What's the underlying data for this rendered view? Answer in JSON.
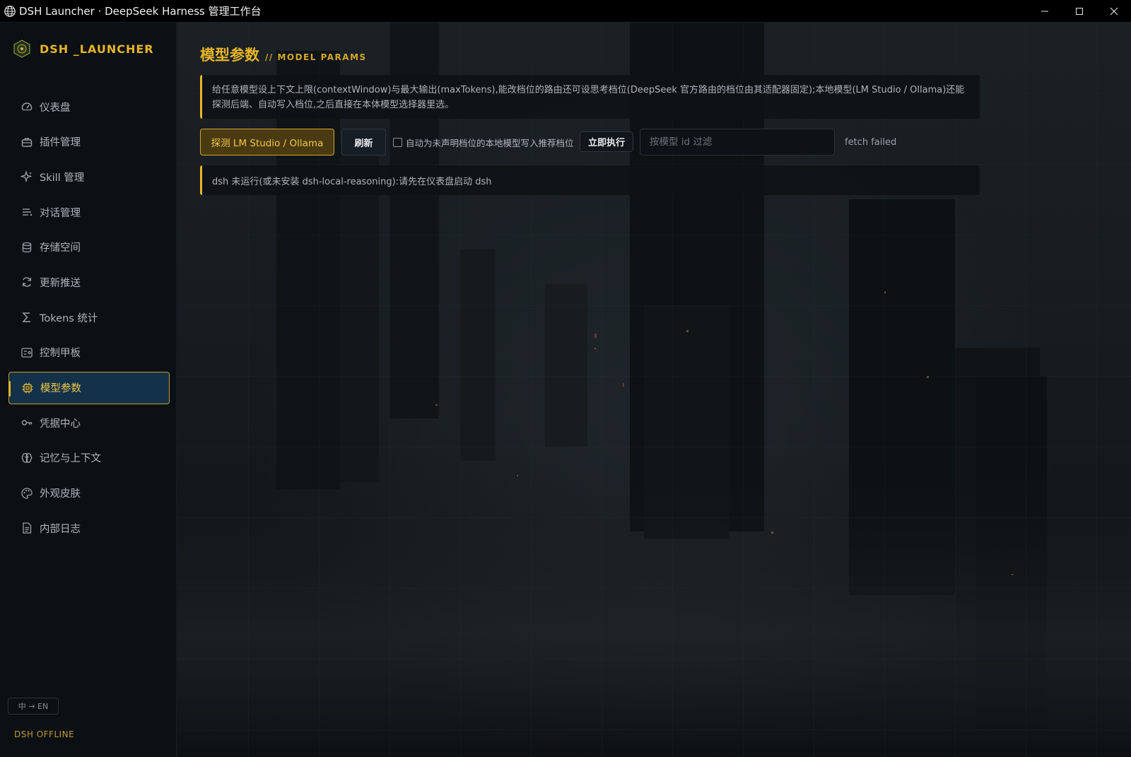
{
  "window": {
    "title": "DSH Launcher · DeepSeek Harness 管理工作台",
    "icon": "globe-icon",
    "controls": [
      "minimize-icon",
      "maximize-icon",
      "close-icon"
    ]
  },
  "brand": {
    "logo": "dsh-logo-icon",
    "name": "DSH _LAUNCHER",
    "color": "#e7b42a"
  },
  "sidebar": {
    "items": [
      {
        "label": "仪表盘",
        "icon": "gauge-icon",
        "active": false
      },
      {
        "label": "插件管理",
        "icon": "briefcase-icon",
        "active": false
      },
      {
        "label": "Skill 管理",
        "icon": "sparkle-icon",
        "active": false
      },
      {
        "label": "对话管理",
        "icon": "chat-list-icon",
        "active": false
      },
      {
        "label": "存储空间",
        "icon": "database-icon",
        "active": false
      },
      {
        "label": "更新推送",
        "icon": "refresh-icon",
        "active": false
      },
      {
        "label": "Tokens 统计",
        "icon": "sigma-icon",
        "active": false
      },
      {
        "label": "控制甲板",
        "icon": "control-panel-icon",
        "active": false
      },
      {
        "label": "模型参数",
        "icon": "chip-icon",
        "active": true
      },
      {
        "label": "凭据中心",
        "icon": "key-icon",
        "active": false
      },
      {
        "label": "记忆与上下文",
        "icon": "brain-icon",
        "active": false
      },
      {
        "label": "外观皮肤",
        "icon": "palette-icon",
        "active": false
      },
      {
        "label": "内部日志",
        "icon": "document-icon",
        "active": false
      }
    ],
    "lang_toggle": "中 → EN",
    "status": "DSH OFFLINE"
  },
  "main": {
    "title": "模型参数",
    "subtitle": "// MODEL PARAMS",
    "info": "给任意模型设上下文上限(contextWindow)与最大输出(maxTokens),能改档位的路由还可设思考档位(DeepSeek 官方路由的档位由其适配器固定);本地模型(LM Studio / Ollama)还能探测后端、自动写入档位,之后直接在本体模型选择器里选。",
    "detect_button": "探测 LM Studio / Ollama",
    "refresh_button": "刷新",
    "auto_write_label": "自动为未声明档位的本地模型写入推荐档位",
    "auto_write_checked": false,
    "run_button": "立即执行",
    "filter_placeholder": "按模型 id 过滤",
    "filter_value": "",
    "fetch_status": "fetch failed",
    "warning": "dsh 未运行(或未安装 dsh-local-reasoning):请先在仪表盘启动 dsh"
  },
  "colors": {
    "accent": "#e7b42a",
    "active_bg": "#13324a",
    "sidebar_bg": "#0b1014",
    "titlebar_bg": "#000000"
  }
}
